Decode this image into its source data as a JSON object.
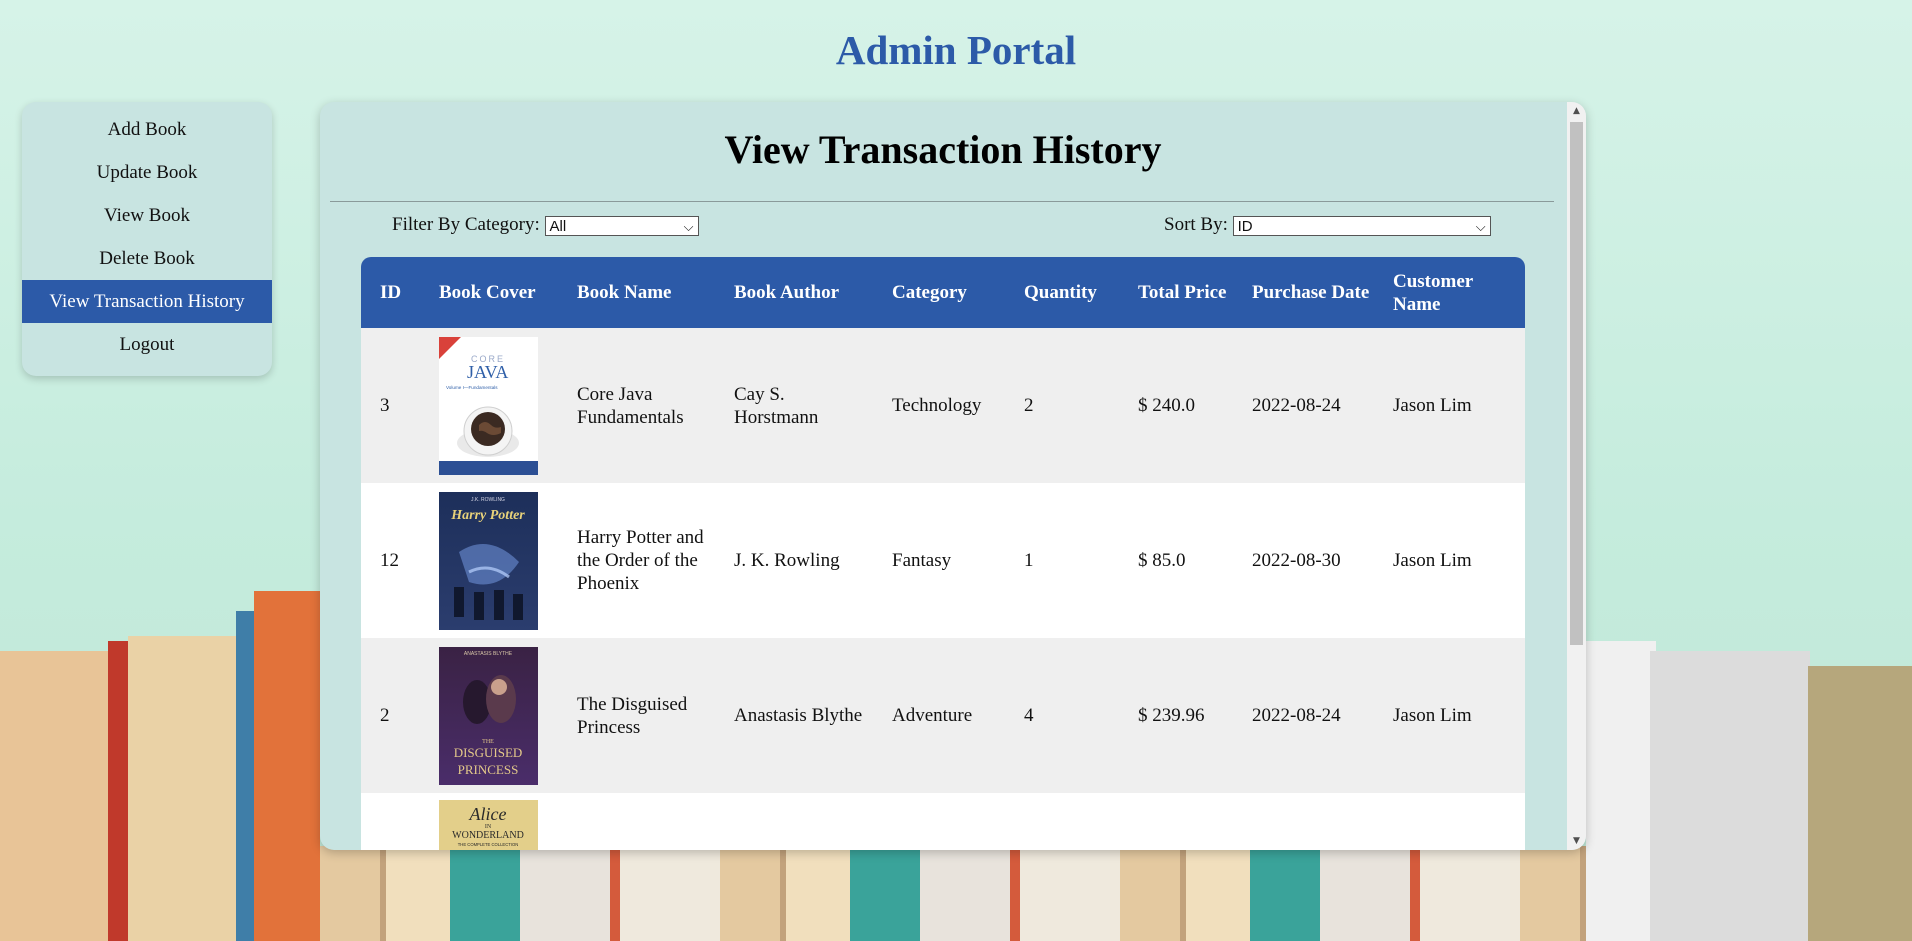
{
  "app_title": "Admin Portal",
  "sidebar": {
    "items": [
      {
        "label": "Add Book"
      },
      {
        "label": "Update Book"
      },
      {
        "label": "View Book"
      },
      {
        "label": "Delete Book"
      },
      {
        "label": "View Transaction History",
        "active": true
      },
      {
        "label": "Logout"
      }
    ]
  },
  "main": {
    "title": "View Transaction History",
    "filter": {
      "label": "Filter By Category:",
      "value": "All"
    },
    "sort": {
      "label": "Sort By:",
      "value": "ID"
    },
    "columns": [
      "ID",
      "Book Cover",
      "Book Name",
      "Book Author",
      "Category",
      "Quantity",
      "Total Price",
      "Purchase Date",
      "Customer Name"
    ],
    "rows": [
      {
        "id": "3",
        "cover": "core-java-cover",
        "name": "Core Java Fundamentals",
        "author": "Cay S. Horstmann",
        "category": "Technology",
        "quantity": "2",
        "price": "$ 240.0",
        "date": "2022-08-24",
        "customer": "Jason Lim"
      },
      {
        "id": "12",
        "cover": "harry-potter-cover",
        "name": "Harry Potter and the Order of the Phoenix",
        "author": "J. K. Rowling",
        "category": "Fantasy",
        "quantity": "1",
        "price": "$ 85.0",
        "date": "2022-08-30",
        "customer": "Jason Lim"
      },
      {
        "id": "2",
        "cover": "disguised-princess-cover",
        "name": "The Disguised Princess",
        "author": "Anastasis Blythe",
        "category": "Adventure",
        "quantity": "4",
        "price": "$ 239.96",
        "date": "2022-08-24",
        "customer": "Jason Lim"
      },
      {
        "id": "",
        "cover": "alice-in-wonderland-cover",
        "name": "",
        "author": "",
        "category": "",
        "quantity": "",
        "price": "",
        "date": "",
        "customer": ""
      }
    ]
  },
  "covers": {
    "core_java": {
      "line1": "CORE",
      "line2": "JAVA",
      "line3": "Volume I—Fundamentals"
    },
    "harry_potter": {
      "top": "J.K. ROWLING",
      "title": "Harry Potter"
    },
    "disguised_princess": {
      "top": "ANASTASIS BLYTHE",
      "title1": "THE",
      "title2": "DISGUISED",
      "title3": "PRINCESS"
    },
    "alice": {
      "title1": "Alice",
      "title2": "IN",
      "title3": "WONDERLAND",
      "sub": "THE COMPLETE COLLECTION"
    }
  },
  "colors": {
    "accent": "#2c5aa8",
    "panel": "#c8e4e1",
    "row_alt": "#efefef"
  }
}
